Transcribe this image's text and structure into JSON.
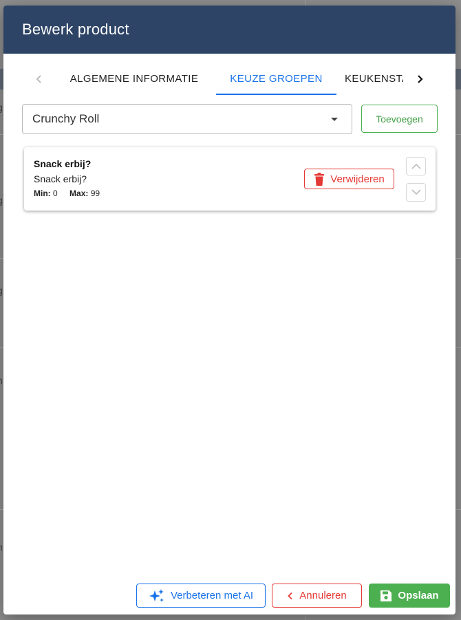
{
  "dialog": {
    "title": "Bewerk product"
  },
  "tabs": {
    "items": [
      {
        "label": "ALGEMENE INFORMATIE"
      },
      {
        "label": "KEUZE GROEPEN"
      },
      {
        "label": "KEUKENSTATION"
      }
    ],
    "active_label": "KEUZE GROEPEN",
    "prev_icon": "chevron-left-icon",
    "next_icon": "chevron-right-icon"
  },
  "choice_group_select": {
    "selected": "Crunchy Roll",
    "icon": "caret-down-icon"
  },
  "add_button": {
    "label": "Toevoegen"
  },
  "groups": [
    {
      "title": "Snack erbij?",
      "subtitle": "Snack erbij?",
      "min_label": "Min:",
      "min_value": "0",
      "max_label": "Max:",
      "max_value": "99",
      "delete_label": "Verwijderen",
      "delete_icon": "trash-icon",
      "move_up_icon": "chevron-up-icon",
      "move_down_icon": "chevron-down-icon"
    }
  ],
  "footer": {
    "ai_label": "Verbeteren met AI",
    "ai_icon": "sparkle-icon",
    "cancel_label": "Annuleren",
    "cancel_icon": "chevron-left-icon",
    "save_label": "Opslaan",
    "save_icon": "floppy-disk-icon"
  },
  "colors": {
    "header": "#2e4466",
    "accent": "#1a73e8",
    "success": "#4caf50",
    "danger": "#e53935"
  }
}
